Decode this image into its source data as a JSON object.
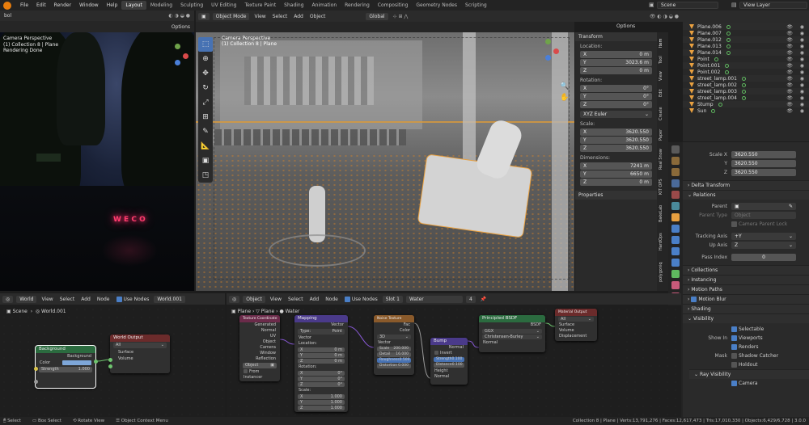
{
  "topbar": {
    "menus": [
      "File",
      "Edit",
      "Render",
      "Window",
      "Help"
    ],
    "workspaces": [
      "Layout",
      "Modeling",
      "Sculpting",
      "UV Editing",
      "Texture Paint",
      "Shading",
      "Animation",
      "Rendering",
      "Compositing",
      "Geometry Nodes",
      "Scripting"
    ],
    "active_workspace": "Layout",
    "scene": "Scene",
    "view_layer": "View Layer"
  },
  "render_view": {
    "header_left": "bol",
    "options": "Options",
    "overlay_line1": "Camera Perspective",
    "overlay_line2": "(1) Collection 8 | Plane",
    "overlay_line3": "Rendering Done",
    "neon_sign": "W E C O"
  },
  "viewport": {
    "mode": "Object Mode",
    "menus": [
      "View",
      "Select",
      "Add",
      "Object"
    ],
    "orientation": "Global",
    "options": "Options",
    "overlay_line1": "Camera Perspective",
    "overlay_line2": "(1) Collection 8 | Plane"
  },
  "npanel": {
    "title": "Transform",
    "location_label": "Location:",
    "location": [
      {
        "axis": "X",
        "value": "0 m"
      },
      {
        "axis": "Y",
        "value": "3023.6 m"
      },
      {
        "axis": "Z",
        "value": "0 m"
      }
    ],
    "rotation_label": "Rotation:",
    "rotation": [
      {
        "axis": "X",
        "value": "0°"
      },
      {
        "axis": "Y",
        "value": "0°"
      },
      {
        "axis": "Z",
        "value": "0°"
      }
    ],
    "rotation_mode": "XYZ Euler",
    "scale_label": "Scale:",
    "scale": [
      {
        "axis": "X",
        "value": "3620.550"
      },
      {
        "axis": "Y",
        "value": "3620.550"
      },
      {
        "axis": "Z",
        "value": "3620.550"
      }
    ],
    "dimensions_label": "Dimensions:",
    "dimensions": [
      {
        "axis": "X",
        "value": "7241 m"
      },
      {
        "axis": "Y",
        "value": "6650 m"
      },
      {
        "axis": "Z",
        "value": "0 m"
      }
    ],
    "properties_label": "Properties"
  },
  "vtabs": [
    "Item",
    "Tool",
    "View",
    "Edit",
    "Create",
    "Paper",
    "Real Snow",
    "KIT OPS",
    "BakeLab",
    "HardOps",
    "polygoniq"
  ],
  "outliner": {
    "items": [
      {
        "name": "Plane.006",
        "icon_color": "#e8a040"
      },
      {
        "name": "Plane.007",
        "icon_color": "#e8a040"
      },
      {
        "name": "Plane.012",
        "icon_color": "#e8a040"
      },
      {
        "name": "Plane.013",
        "icon_color": "#e8a040"
      },
      {
        "name": "Plane.014",
        "icon_color": "#e8a040"
      },
      {
        "name": "Point",
        "icon_color": "#e8a040"
      },
      {
        "name": "Point.001",
        "icon_color": "#e8a040"
      },
      {
        "name": "Point.002",
        "icon_color": "#e8a040"
      },
      {
        "name": "street_lamp.001",
        "icon_color": "#e8a040"
      },
      {
        "name": "street_lamp.002",
        "icon_color": "#e8a040"
      },
      {
        "name": "street_lamp.003",
        "icon_color": "#e8a040"
      },
      {
        "name": "street_lamp.004",
        "icon_color": "#e8a040"
      },
      {
        "name": "Stump",
        "icon_color": "#e8a040"
      },
      {
        "name": "Sun",
        "icon_color": "#e8a040"
      }
    ]
  },
  "properties": {
    "scale_rows": [
      {
        "label": "Scale X",
        "value": "3620.550"
      },
      {
        "label": "Y",
        "value": "3620.550"
      },
      {
        "label": "Z",
        "value": "3620.550"
      }
    ],
    "delta_transform": "Delta Transform",
    "relations": "Relations",
    "parent_label": "Parent",
    "parent_type_label": "Parent Type",
    "parent_type_value": "Object",
    "camera_parent_lock": "Camera Parent Lock",
    "tracking_axis_label": "Tracking Axis",
    "tracking_axis_value": "+Y",
    "up_axis_label": "Up Axis",
    "up_axis_value": "Z",
    "pass_index_label": "Pass Index",
    "pass_index_value": "0",
    "collections": "Collections",
    "instancing": "Instancing",
    "motion_paths": "Motion Paths",
    "motion_blur": "Motion Blur",
    "shading": "Shading",
    "visibility": "Visibility",
    "selectable": "Selectable",
    "show_in_label": "Show In",
    "viewports": "Viewports",
    "renders": "Renders",
    "mask_label": "Mask",
    "shadow_catcher": "Shadow Catcher",
    "holdout": "Holdout",
    "ray_visibility": "Ray Visibility",
    "camera": "Camera"
  },
  "world_editor": {
    "header": {
      "type": "World",
      "menus": [
        "View",
        "Select",
        "Add",
        "Node"
      ],
      "use_nodes": "Use Nodes",
      "world": "World.001"
    },
    "breadcrumb": {
      "scene": "Scene",
      "world": "World.001"
    },
    "background_node": {
      "title": "Background",
      "output": "Background",
      "color_label": "Color",
      "strength_label": "Strength",
      "strength": "1.000",
      "header_color": "#2b6b3f"
    },
    "world_output_node": {
      "title": "World Output",
      "target": "All",
      "surface": "Surface",
      "volume": "Volume",
      "header_color": "#6b2b2b"
    }
  },
  "shader_editor": {
    "header": {
      "type": "Object",
      "menus": [
        "View",
        "Select",
        "Add",
        "Node"
      ],
      "use_nodes": "Use Nodes",
      "slot": "Slot 1",
      "material": "Water",
      "users": "4"
    },
    "breadcrumb": {
      "a": "Plane",
      "b": "Plane",
      "c": "Water"
    },
    "texcoord": {
      "title": "Texture Coordinate",
      "outputs": [
        "Generated",
        "Normal",
        "UV",
        "Object",
        "Camera",
        "Window",
        "Reflection"
      ],
      "object_label": "Object",
      "from_instancer": "From Instancer"
    },
    "mapping": {
      "title": "Mapping",
      "output": "Vector",
      "type_label": "Type:",
      "type_value": "Point",
      "vector": "Vector",
      "location_label": "Location:",
      "location": [
        "0 m",
        "0 m",
        "0 m"
      ],
      "rotation_label": "Rotation:",
      "rotation": [
        "0°",
        "0°",
        "0°"
      ],
      "scale_label": "Scale:",
      "scale": [
        "1.000",
        "1.000",
        "1.000"
      ]
    },
    "noise": {
      "title": "Noise Texture",
      "outputs": [
        "Fac",
        "Color"
      ],
      "dim": "3D",
      "vector": "Vector",
      "fields": [
        {
          "label": "Scale",
          "value": "200.000"
        },
        {
          "label": "Detail",
          "value": "16.000"
        },
        {
          "label": "Roughness",
          "value": "0.500"
        },
        {
          "label": "Distortion",
          "value": "0.000"
        }
      ]
    },
    "bump": {
      "title": "Bump",
      "output": "Normal",
      "invert": "Invert",
      "fields": [
        {
          "label": "Strength",
          "value": "0.100"
        },
        {
          "label": "Distance",
          "value": "0.100"
        }
      ],
      "inputs": [
        "Height",
        "Normal"
      ]
    },
    "bsdf": {
      "title": "Principled BSDF",
      "output": "BSDF",
      "dist": "GGX",
      "sss": "Christensen-Burley",
      "input": "Normal"
    },
    "matout": {
      "title": "Material Output",
      "target": "All",
      "inputs": [
        "Surface",
        "Volume",
        "Displacement"
      ]
    }
  },
  "status": {
    "select": "Select",
    "box_select": "Box Select",
    "rotate_view": "Rotate View",
    "context_menu": "Object Context Menu",
    "stats": "Collection 8 | Plane | Verts:13,791,276 | Faces:12,617,473 | Tris:17,010,330 | Objects:6,429/6,728 | 3.0.0"
  }
}
